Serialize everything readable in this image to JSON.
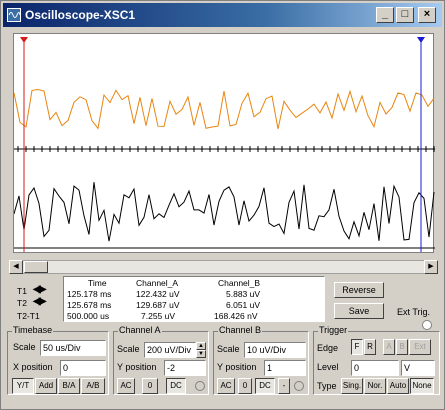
{
  "window": {
    "title": "Oscilloscope-XSC1",
    "minimize": "_",
    "maximize": "□",
    "close": "×"
  },
  "colors": {
    "channel_a_trace": "#e8850f",
    "channel_b_trace": "#000000",
    "cursor_t1": "#d81b1b",
    "cursor_t2": "#1a1ad8",
    "grid_axis": "#000000"
  },
  "readout": {
    "headers": [
      "Time",
      "Channel_A",
      "Channel_B"
    ],
    "rows": [
      {
        "label": "T1",
        "time": "125.178 ms",
        "channel_a": "122.432 uV",
        "channel_b": "5.883 uV"
      },
      {
        "label": "T2",
        "time": "125.678 ms",
        "channel_a": "129.687 uV",
        "channel_b": "6.051 uV"
      },
      {
        "label": "T2-T1",
        "time": "500.000 us",
        "channel_a": "7.255 uV",
        "channel_b": "168.426 nV"
      }
    ]
  },
  "actions": {
    "reverse": "Reverse",
    "save": "Save",
    "ext_trig": "Ext Trig."
  },
  "timebase": {
    "title": "Timebase",
    "scale_label": "Scale",
    "scale_value": "50 us/Div",
    "xpos_label": "X position",
    "xpos_value": "0",
    "modes": [
      "Y/T",
      "Add",
      "B/A",
      "A/B"
    ]
  },
  "channel_a": {
    "title": "Channel A",
    "scale_label": "Scale",
    "scale_value": "200 uV/Div",
    "ypos_label": "Y position",
    "ypos_value": "-2",
    "coupling": [
      "AC",
      "0",
      "DC"
    ]
  },
  "channel_b": {
    "title": "Channel B",
    "scale_label": "Scale",
    "scale_value": "10 uV/Div",
    "ypos_label": "Y position",
    "ypos_value": "1",
    "coupling": [
      "AC",
      "0",
      "DC",
      "-"
    ]
  },
  "trigger": {
    "title": "Trigger",
    "edge_label": "Edge",
    "edge_buttons": [
      "F",
      "R"
    ],
    "source_buttons": [
      "A",
      "B",
      "Ext"
    ],
    "level_label": "Level",
    "level_value": "0",
    "level_unit": "V",
    "type_label": "Type",
    "types": [
      "Sing.",
      "Nor.",
      "Auto",
      "None"
    ]
  },
  "icons": {
    "arrows": "left-right-arrow-icon",
    "app": "oscilloscope-icon"
  }
}
